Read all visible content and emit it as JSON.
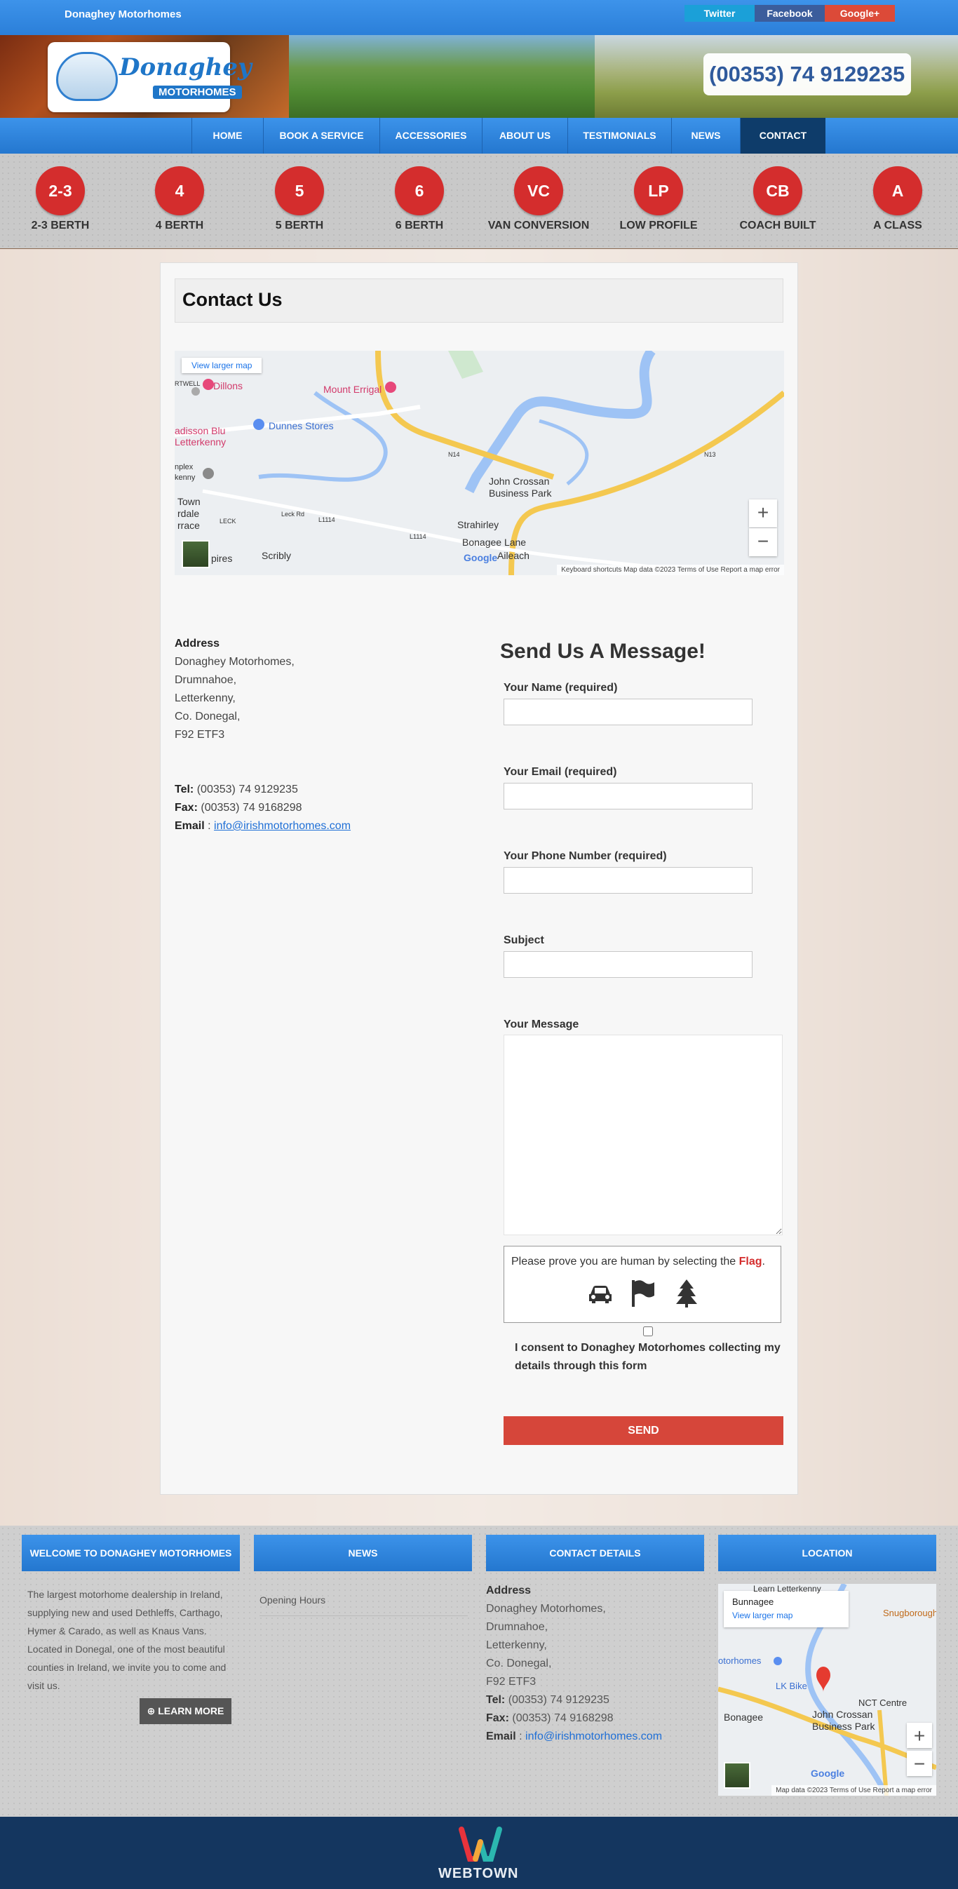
{
  "topbar": {
    "site_name": "Donaghey Motorhomes",
    "twitter": "Twitter",
    "facebook": "Facebook",
    "google": "Google+"
  },
  "header": {
    "logo_main": "Donaghey",
    "logo_sub": "MOTORHOMES",
    "phone": "(00353) 74 9129235"
  },
  "nav": [
    "HOME",
    "BOOK A SERVICE",
    "ACCESSORIES",
    "ABOUT US",
    "TESTIMONIALS",
    "NEWS",
    "CONTACT"
  ],
  "categories": [
    {
      "badge": "2-3",
      "label": "2-3 BERTH"
    },
    {
      "badge": "4",
      "label": "4 BERTH"
    },
    {
      "badge": "5",
      "label": "5 BERTH"
    },
    {
      "badge": "6",
      "label": "6 BERTH"
    },
    {
      "badge": "VC",
      "label": "VAN CONVERSION"
    },
    {
      "badge": "LP",
      "label": "LOW PROFILE"
    },
    {
      "badge": "CB",
      "label": "COACH BUILT"
    },
    {
      "badge": "A",
      "label": "A CLASS"
    }
  ],
  "page": {
    "title": "Contact Us"
  },
  "map": {
    "view_larger": "View larger map",
    "labels": [
      "Dillons",
      "Mount Errigal",
      "Dunnes Stores",
      "adisson Blu",
      "Letterkenny",
      "John Crossan",
      "Business Park",
      "Strahirley",
      "Bonagee Lane",
      "Aileach",
      "Scribly",
      "Town",
      "rdale",
      "rrace",
      "pires",
      "RTWELL",
      "nplex",
      "kenny",
      "LECK",
      "Leck Rd",
      "L1114",
      "N14",
      "N13",
      "L1114"
    ],
    "footer": "Keyboard shortcuts   Map data ©2023   Terms of Use   Report a map error",
    "google": "Google",
    "zoom_in": "+",
    "zoom_out": "−"
  },
  "address": {
    "heading": "Address",
    "lines": [
      "Donaghey Motorhomes,",
      "Drumnahoe,",
      "Letterkenny,",
      "Co. Donegal,",
      "F92 ETF3"
    ],
    "tel_label": "Tel:",
    "tel": "(00353) 74 9129235",
    "fax_label": "Fax:",
    "fax": "(00353) 74 9168298",
    "email_label": "Email",
    "email_sep": ":",
    "email": "info@irishmotorhomes.com"
  },
  "form": {
    "title": "Send Us A Message!",
    "name_label": "Your Name (required)",
    "email_label": "Your Email (required)",
    "phone_label": "Your Phone Number (required)",
    "subject_label": "Subject",
    "message_label": "Your Message",
    "captcha_text": "Please prove you are human by selecting the",
    "captcha_target": "Flag",
    "captcha_end": ".",
    "consent": "I consent to Donaghey Motorhomes collecting my details through this form",
    "send": "SEND"
  },
  "footer": {
    "welcome_head": "WELCOME TO DONAGHEY MOTORHOMES",
    "welcome_text": "The largest motorhome dealership in Ireland, supplying new and used Dethleffs, Carthago, Hymer & Carado, as well as Knaus Vans. Located in Donegal, one of the most beautiful counties in Ireland, we invite you to come and visit us.",
    "learn_more": "⊕ LEARN MORE",
    "news_head": "NEWS",
    "news_item": "Opening Hours",
    "contact_head": "CONTACT DETAILS",
    "location_head": "LOCATION",
    "map_place": "Bunnagee",
    "map_link": "View larger map",
    "map_labels": [
      "Learn Letterkenny",
      "Snugborough",
      "otorhomes",
      "LK Bike",
      "NCT Centre",
      "Bonagee",
      "John Crossan",
      "Business Park",
      "Google"
    ],
    "map_footer": "Map data ©2023   Terms of Use   Report a map error"
  },
  "bottom": {
    "brand": "WEBTOWN"
  },
  "colors": {
    "accent": "#2b7fd9",
    "nav_active": "#0e3c6a",
    "badge": "#d42d2d",
    "send": "#d6463a",
    "bottom": "#14365f"
  }
}
